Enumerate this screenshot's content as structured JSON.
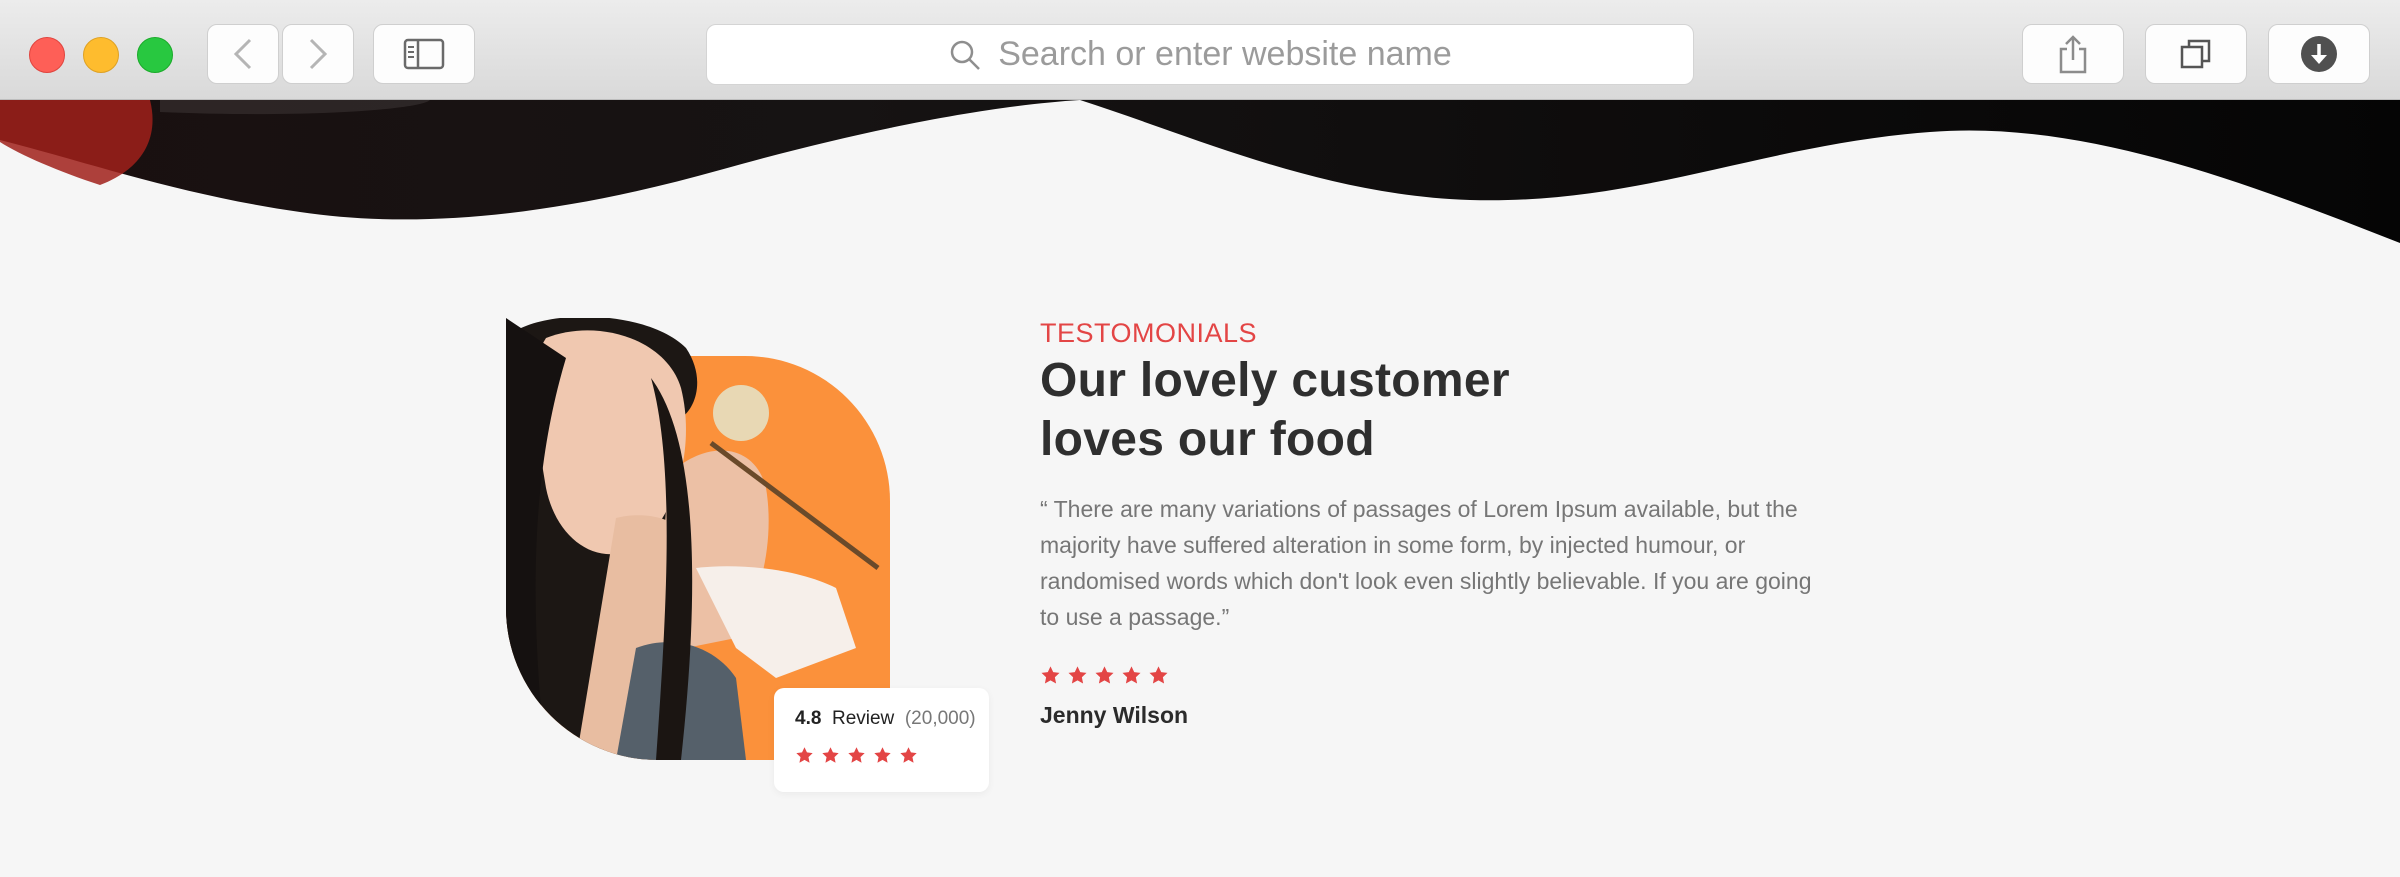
{
  "browser": {
    "url_placeholder": "Search or enter website name",
    "icons": [
      "back-chevron-icon",
      "forward-chevron-icon",
      "sidebar-icon",
      "search-icon",
      "share-icon",
      "tabs-icon",
      "download-icon"
    ],
    "traffic_lights": [
      "#fe5f57",
      "#febc2e",
      "#28c840"
    ]
  },
  "testimonial": {
    "eyebrow": "TESTOMONIALS",
    "heading_line1": "Our lovely customer",
    "heading_line2": "loves our food",
    "quote": "“ There are many variations of passages of Lorem Ipsum available, but the majority have suffered alteration in some form, by injected humour, or randomised words which don't look even slightly believable. If you are going to use a passage.”",
    "rating_stars": 5,
    "author": "Jenny Wilson"
  },
  "review_card": {
    "score": "4.8",
    "label": "Review",
    "count": "(20,000)",
    "stars": 5
  },
  "colors": {
    "accent": "#e34545",
    "orange_blob": "#fb913b",
    "page_bg": "#f6f6f6"
  }
}
